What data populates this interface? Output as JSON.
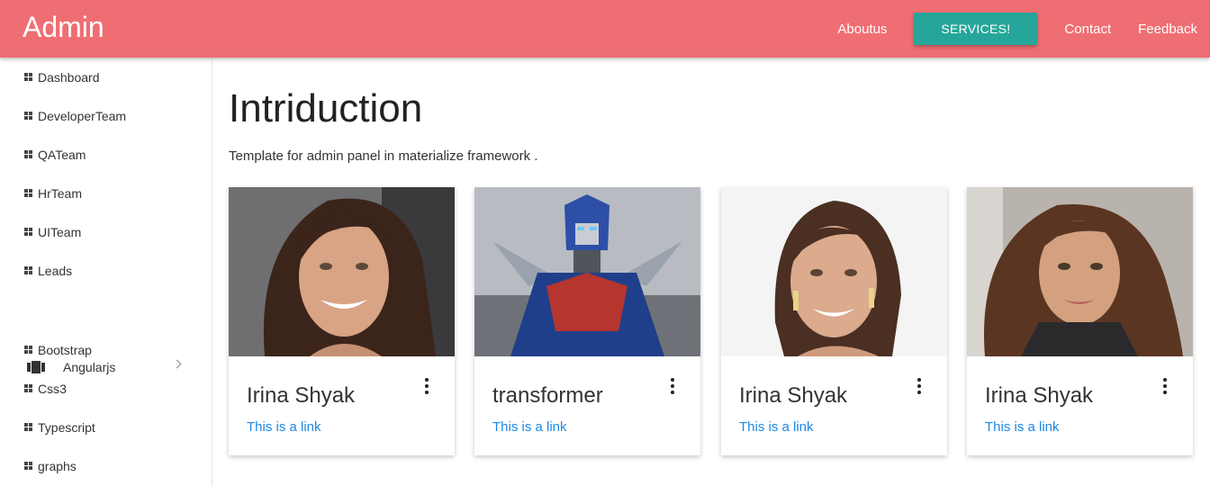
{
  "navbar": {
    "brand": "Admin",
    "links": {
      "aboutus": "Aboutus",
      "services": "SERVICES!",
      "contact": "Contact",
      "feedback": "Feedback"
    },
    "bg_color": "#ef6e73",
    "button_color": "#26a69a"
  },
  "sidebar": {
    "items": [
      {
        "label": "Dashboard",
        "icon": "dashboard-icon"
      },
      {
        "label": "DeveloperTeam",
        "icon": "dashboard-icon"
      },
      {
        "label": "QATeam",
        "icon": "dashboard-icon"
      },
      {
        "label": "HrTeam",
        "icon": "dashboard-icon"
      },
      {
        "label": "UITeam",
        "icon": "dashboard-icon"
      },
      {
        "label": "Leads",
        "icon": "dashboard-icon"
      },
      {
        "label": "Angularjs",
        "icon": "view-array-icon",
        "expandable": true
      },
      {
        "label": "Bootstrap",
        "icon": "dashboard-icon"
      },
      {
        "label": "Css3",
        "icon": "dashboard-icon"
      },
      {
        "label": "Typescript",
        "icon": "dashboard-icon"
      },
      {
        "label": "graphs",
        "icon": "dashboard-icon"
      }
    ]
  },
  "main": {
    "title": "Intriduction",
    "subtitle": "Template for admin panel in materialize framework .",
    "cards": [
      {
        "title": "Irina Shyak",
        "link": "This is a link",
        "image": "portrait-photo"
      },
      {
        "title": "transformer",
        "link": "This is a link",
        "image": "robot-photo"
      },
      {
        "title": "Irina Shyak",
        "link": "This is a link",
        "image": "portrait-photo"
      },
      {
        "title": "Irina Shyak",
        "link": "This is a link",
        "image": "portrait-photo"
      }
    ]
  }
}
